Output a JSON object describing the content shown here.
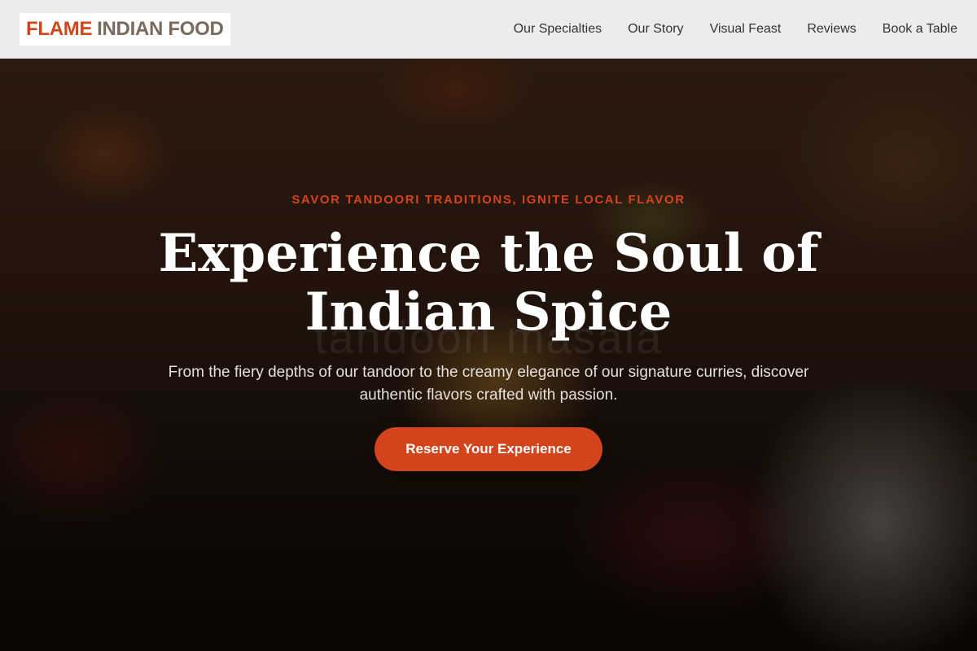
{
  "brand": {
    "name_primary": "FLAME",
    "name_secondary": "INDIAN FOOD",
    "accent_color": "#d4441c"
  },
  "nav": {
    "items": [
      {
        "label": "Our Specialties"
      },
      {
        "label": "Our Story"
      },
      {
        "label": "Visual Feast"
      },
      {
        "label": "Reviews"
      },
      {
        "label": "Book a Table"
      }
    ]
  },
  "hero": {
    "tagline": "SAVOR TANDOORI TRADITIONS, IGNITE LOCAL FLAVOR",
    "headline": "Experience the Soul of Indian Spice",
    "watermark": "tandoori masala",
    "subtext": "From the fiery depths of our tandoor to the creamy elegance of our signature curries, discover authentic flavors crafted with passion.",
    "cta_label": "Reserve Your Experience"
  }
}
